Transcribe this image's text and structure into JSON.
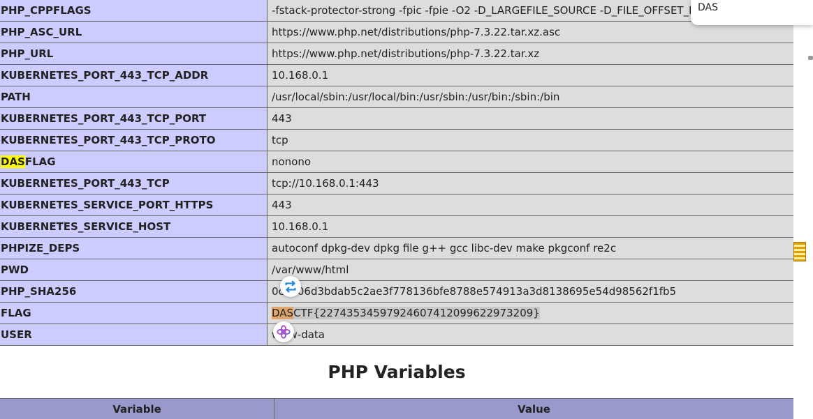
{
  "env_rows": [
    {
      "key": "PHP_CPPFLAGS",
      "value": "-fstack-protector-strong -fpic -fpie -O2 -D_LARGEFILE_SOURCE -D_FILE_OFFSET_BITS=64"
    },
    {
      "key": "PHP_ASC_URL",
      "value": "https://www.php.net/distributions/php-7.3.22.tar.xz.asc"
    },
    {
      "key": "PHP_URL",
      "value": "https://www.php.net/distributions/php-7.3.22.tar.xz"
    },
    {
      "key": "KUBERNETES_PORT_443_TCP_ADDR",
      "value": "10.168.0.1"
    },
    {
      "key": "PATH",
      "value": "/usr/local/sbin:/usr/local/bin:/usr/sbin:/usr/bin:/sbin:/bin"
    },
    {
      "key": "KUBERNETES_PORT_443_TCP_PORT",
      "value": "443"
    },
    {
      "key": "KUBERNETES_PORT_443_TCP_PROTO",
      "value": "tcp"
    },
    {
      "key_highlight": "DAS",
      "key_rest": "FLAG",
      "value": "nonono"
    },
    {
      "key": "KUBERNETES_PORT_443_TCP",
      "value": "tcp://10.168.0.1:443"
    },
    {
      "key": "KUBERNETES_SERVICE_PORT_HTTPS",
      "value": "443"
    },
    {
      "key": "KUBERNETES_SERVICE_HOST",
      "value": "10.168.0.1"
    },
    {
      "key": "PHPIZE_DEPS",
      "value": "autoconf dpkg-dev dpkg file g++ gcc libc-dev make pkgconf re2c"
    },
    {
      "key": "PWD",
      "value": "/var/www/html"
    },
    {
      "key": "PHP_SHA256",
      "value": "0c0306d3bdab5c2ae3f778136bfe8788e574913a3d8138695e54d98562f1fb5"
    },
    {
      "key": "FLAG",
      "value_highlight": "DAS",
      "value_rest": "CTF{22743534597924607412099622973209}"
    },
    {
      "key": "USER",
      "value": "www-data"
    }
  ],
  "section_title": "PHP Variables",
  "variables_header": {
    "col1": "Variable",
    "col2": "Value"
  },
  "find_popup": {
    "query": "DAS"
  },
  "icons": {
    "translate": "repeat-arrows-icon",
    "ai": "openai-knot-icon"
  },
  "colors": {
    "key_bg": "#ccccff",
    "value_bg": "#dddddd",
    "header_bg": "#9999cc",
    "match_highlight": "#ffff00"
  }
}
